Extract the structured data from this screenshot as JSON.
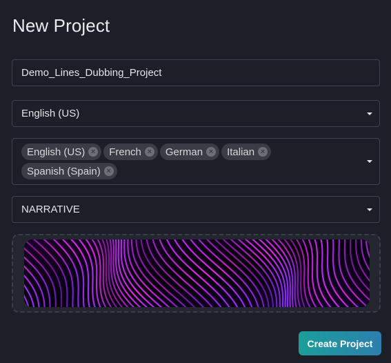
{
  "page": {
    "title": "New Project"
  },
  "project_name": {
    "value": "Demo_Lines_Dubbing_Project"
  },
  "source_language": {
    "value": "English (US)"
  },
  "target_languages": {
    "selected": [
      {
        "label": "English (US)"
      },
      {
        "label": "French"
      },
      {
        "label": "German"
      },
      {
        "label": "Italian"
      },
      {
        "label": "Spanish (Spain)"
      }
    ]
  },
  "style": {
    "value": "NARRATIVE"
  },
  "thumbnail": {
    "icon": "abstract-wave-lines-image",
    "colors": [
      "#0a0012",
      "#7a1fd6",
      "#e02ad9"
    ]
  },
  "actions": {
    "create_label": "Create Project"
  },
  "theme": {
    "background": "#1c1f27",
    "border": "#3f434d",
    "accent_start": "#1b9e9a",
    "accent_end": "#2d7fae"
  }
}
